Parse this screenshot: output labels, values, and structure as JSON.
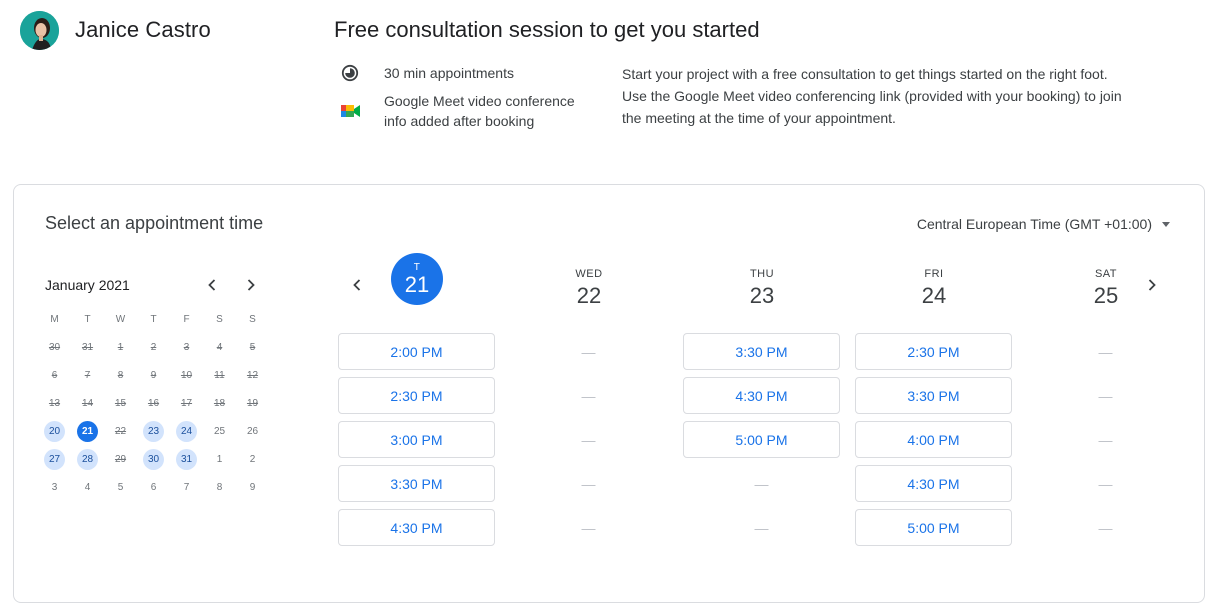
{
  "host": {
    "name": "Janice Castro"
  },
  "session": {
    "title": "Free consultation session to get you started",
    "duration": "30 min appointments",
    "conference_line1": "Google Meet video conference",
    "conference_line2": "info added after booking",
    "description_lines": [
      "Start your project with a free consultation to get things started on the right foot.",
      "Use the Google Meet video conferencing link (provided with your booking) to join",
      "the meeting at the time of your appointment."
    ]
  },
  "booking": {
    "title": "Select an appointment time",
    "timezone": "Central European Time (GMT +01:00)"
  },
  "mini_calendar": {
    "month": "January 2021",
    "weekdays": [
      "M",
      "T",
      "W",
      "T",
      "F",
      "S",
      "S"
    ],
    "days": [
      {
        "label": "30",
        "state": "unavailable"
      },
      {
        "label": "31",
        "state": "unavailable"
      },
      {
        "label": "1",
        "state": "unavailable"
      },
      {
        "label": "2",
        "state": "unavailable"
      },
      {
        "label": "3",
        "state": "unavailable"
      },
      {
        "label": "4",
        "state": "unavailable"
      },
      {
        "label": "5",
        "state": "unavailable"
      },
      {
        "label": "6",
        "state": "unavailable"
      },
      {
        "label": "7",
        "state": "unavailable"
      },
      {
        "label": "8",
        "state": "unavailable"
      },
      {
        "label": "9",
        "state": "unavailable"
      },
      {
        "label": "10",
        "state": "unavailable"
      },
      {
        "label": "11",
        "state": "unavailable"
      },
      {
        "label": "12",
        "state": "unavailable"
      },
      {
        "label": "13",
        "state": "unavailable"
      },
      {
        "label": "14",
        "state": "unavailable"
      },
      {
        "label": "15",
        "state": "unavailable"
      },
      {
        "label": "16",
        "state": "unavailable"
      },
      {
        "label": "17",
        "state": "unavailable"
      },
      {
        "label": "18",
        "state": "unavailable"
      },
      {
        "label": "19",
        "state": "unavailable"
      },
      {
        "label": "20",
        "state": "available"
      },
      {
        "label": "21",
        "state": "selected"
      },
      {
        "label": "22",
        "state": "unavailable"
      },
      {
        "label": "23",
        "state": "available"
      },
      {
        "label": "24",
        "state": "available"
      },
      {
        "label": "25",
        "state": "plain"
      },
      {
        "label": "26",
        "state": "plain"
      },
      {
        "label": "27",
        "state": "available"
      },
      {
        "label": "28",
        "state": "available"
      },
      {
        "label": "29",
        "state": "unavailable"
      },
      {
        "label": "30",
        "state": "available"
      },
      {
        "label": "31",
        "state": "available"
      },
      {
        "label": "1",
        "state": "plain"
      },
      {
        "label": "2",
        "state": "plain"
      },
      {
        "label": "3",
        "state": "plain"
      },
      {
        "label": "4",
        "state": "plain"
      },
      {
        "label": "5",
        "state": "plain"
      },
      {
        "label": "6",
        "state": "plain"
      },
      {
        "label": "7",
        "state": "plain"
      },
      {
        "label": "8",
        "state": "plain"
      },
      {
        "label": "9",
        "state": "plain"
      }
    ]
  },
  "week": {
    "days": [
      {
        "dow": "T",
        "date": "21",
        "selected": true,
        "slots": [
          "2:00 PM",
          "2:30 PM",
          "3:00 PM",
          "3:30 PM",
          "4:30 PM"
        ]
      },
      {
        "dow": "WED",
        "date": "22",
        "selected": false,
        "slots": [
          "—",
          "—",
          "—",
          "—",
          "—"
        ]
      },
      {
        "dow": "THU",
        "date": "23",
        "selected": false,
        "slots": [
          "3:30 PM",
          "4:30 PM",
          "5:00 PM",
          "—",
          "—"
        ]
      },
      {
        "dow": "FRI",
        "date": "24",
        "selected": false,
        "slots": [
          "2:30 PM",
          "3:30 PM",
          "4:00 PM",
          "4:30 PM",
          "5:00 PM"
        ]
      },
      {
        "dow": "SAT",
        "date": "25",
        "selected": false,
        "slots": [
          "—",
          "—",
          "—",
          "—",
          "—"
        ]
      }
    ]
  },
  "icons": {
    "duration": "clock-icon",
    "conference": "google-meet-icon",
    "prev": "chevron-left-icon",
    "next": "chevron-right-icon",
    "dropdown": "caret-down-icon"
  },
  "colors": {
    "accent": "#1a73e8",
    "available_day": "#d2e3fc",
    "avatar_bg": "#1aa39a"
  }
}
